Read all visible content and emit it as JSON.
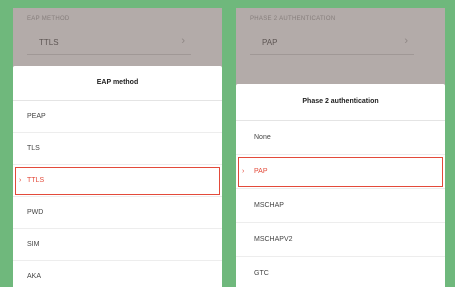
{
  "colors": {
    "background": "#6fb87c",
    "selected": "#e34a3a"
  },
  "left": {
    "bg_label": "EAP METHOD",
    "bg_value": "TTLS",
    "sheet_title": "EAP method",
    "options": [
      "PEAP",
      "TLS",
      "TTLS",
      "PWD",
      "SIM",
      "AKA"
    ],
    "selected": "TTLS"
  },
  "right": {
    "bg_label": "PHASE 2 AUTHENTICATION",
    "bg_value": "PAP",
    "sheet_title": "Phase 2 authentication",
    "options": [
      "None",
      "PAP",
      "MSCHAP",
      "MSCHAPV2",
      "GTC"
    ],
    "selected": "PAP"
  },
  "icons": {
    "chevron": "chevron-right-icon",
    "selected_marker": "radio-selected-icon"
  }
}
